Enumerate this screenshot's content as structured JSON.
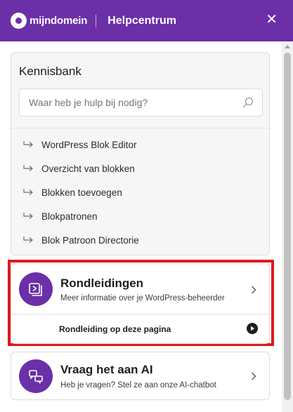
{
  "header": {
    "brand": "mijndomein",
    "title": "Helpcentrum",
    "close_symbol": "✕"
  },
  "kennisbank": {
    "title": "Kennisbank",
    "search_placeholder": "Waar heb je hulp bij nodig?",
    "items": [
      {
        "label": "WordPress Blok Editor"
      },
      {
        "label": "Overzicht van blokken"
      },
      {
        "label": "Blokken toevoegen"
      },
      {
        "label": "Blokpatronen"
      },
      {
        "label": "Blok Patroon Directorie"
      }
    ]
  },
  "tours": {
    "title": "Rondleidingen",
    "subtitle": "Meer informatie over je WordPress-beheerder",
    "link_label": "Rondleiding op deze pagina",
    "highlight_color": "#e0181f"
  },
  "ai": {
    "title": "Vraag het aan AI",
    "subtitle": "Heb je vragen? Stel ze aan onze AI-chatbot"
  },
  "colors": {
    "brand_purple": "#6b2fa8",
    "highlight_red": "#e0181f"
  },
  "icons": {
    "search": "search-icon",
    "close": "close-icon",
    "list_arrow": "return-arrow-icon",
    "tours": "play-slides-icon",
    "chevron": "chevron-right-icon",
    "play": "play-icon",
    "ai": "chat-bubbles-icon"
  }
}
